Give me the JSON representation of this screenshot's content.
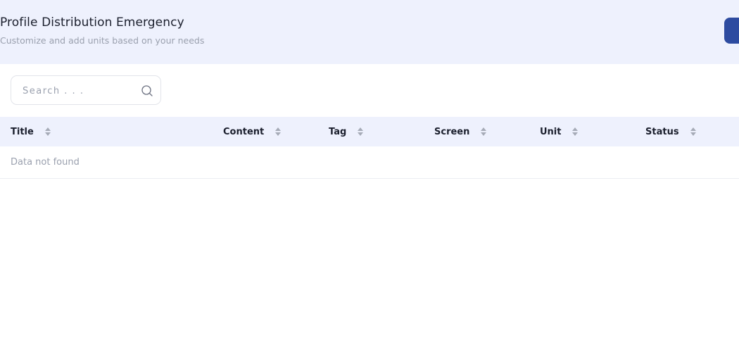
{
  "header": {
    "title": "Profile Distribution Emergency",
    "subtitle": "Customize and add units based on your needs"
  },
  "search": {
    "placeholder": "Search . . .",
    "value": "",
    "icon": "search-icon"
  },
  "table": {
    "columns": [
      {
        "label": "Title"
      },
      {
        "label": "Content"
      },
      {
        "label": "Tag"
      },
      {
        "label": "Screen"
      },
      {
        "label": "Unit"
      },
      {
        "label": "Status"
      }
    ],
    "empty_message": "Data not found"
  },
  "colors": {
    "header_bg": "#eef1fd",
    "accent": "#2d4ba0",
    "muted_text": "#9aa0ae"
  }
}
